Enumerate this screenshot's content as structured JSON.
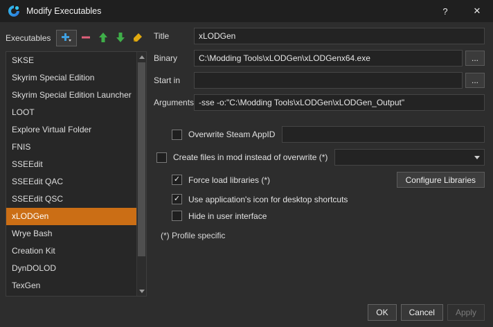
{
  "window": {
    "title": "Modify Executables",
    "help": "?",
    "close": "✕"
  },
  "executables": {
    "label": "Executables",
    "items": [
      {
        "label": "SKSE",
        "selected": false
      },
      {
        "label": "Skyrim Special Edition",
        "selected": false
      },
      {
        "label": "Skyrim Special Edition Launcher",
        "selected": false
      },
      {
        "label": "LOOT",
        "selected": false
      },
      {
        "label": "Explore Virtual Folder",
        "selected": false
      },
      {
        "label": "FNIS",
        "selected": false
      },
      {
        "label": "SSEEdit",
        "selected": false
      },
      {
        "label": "SSEEdit QAC",
        "selected": false
      },
      {
        "label": "SSEEdit QSC",
        "selected": false
      },
      {
        "label": "xLODGen",
        "selected": true
      },
      {
        "label": "Wrye Bash",
        "selected": false
      },
      {
        "label": "Creation Kit",
        "selected": false
      },
      {
        "label": "DynDOLOD",
        "selected": false
      },
      {
        "label": "TexGen",
        "selected": false
      }
    ]
  },
  "form": {
    "fields": {
      "title": {
        "label": "Title",
        "value": "xLODGen"
      },
      "binary": {
        "label": "Binary",
        "value": "C:\\Modding Tools\\xLODGen\\xLODGenx64.exe",
        "browse": "..."
      },
      "start_in": {
        "label": "Start in",
        "value": "",
        "browse": "..."
      },
      "arguments": {
        "label": "Arguments",
        "value": "-sse -o:\"C:\\Modding Tools\\xLODGen\\xLODGen_Output\""
      }
    },
    "options": {
      "overwrite_appid": {
        "label": "Overwrite Steam AppID",
        "checked": false,
        "value": ""
      },
      "create_files": {
        "label": "Create files in mod instead of overwrite (*)",
        "checked": false,
        "selected_value": ""
      },
      "force_load": {
        "label": "Force load libraries (*)",
        "checked": true,
        "button": "Configure Libraries"
      },
      "app_icon": {
        "label": "Use application's icon for desktop shortcuts",
        "checked": true
      },
      "hide_ui": {
        "label": "Hide in user interface",
        "checked": false
      }
    },
    "note": "(*) Profile specific"
  },
  "footer": {
    "ok": "OK",
    "cancel": "Cancel",
    "apply": "Apply"
  },
  "icons": {
    "app": "mo2-logo-icon",
    "add": "plus-icon",
    "remove": "minus-icon",
    "move_up": "arrow-up-icon",
    "move_down": "arrow-down-icon",
    "brush": "brush-icon",
    "help": "question-mark-icon",
    "close": "x-icon",
    "dropdown": "chevron-down-icon"
  },
  "colors": {
    "selected_item": "#cb6e15",
    "add_icon": "#3f9fe0",
    "remove_icon": "#e0607a",
    "move_icon": "#3fae49",
    "brush_icon": "#e0a910"
  }
}
